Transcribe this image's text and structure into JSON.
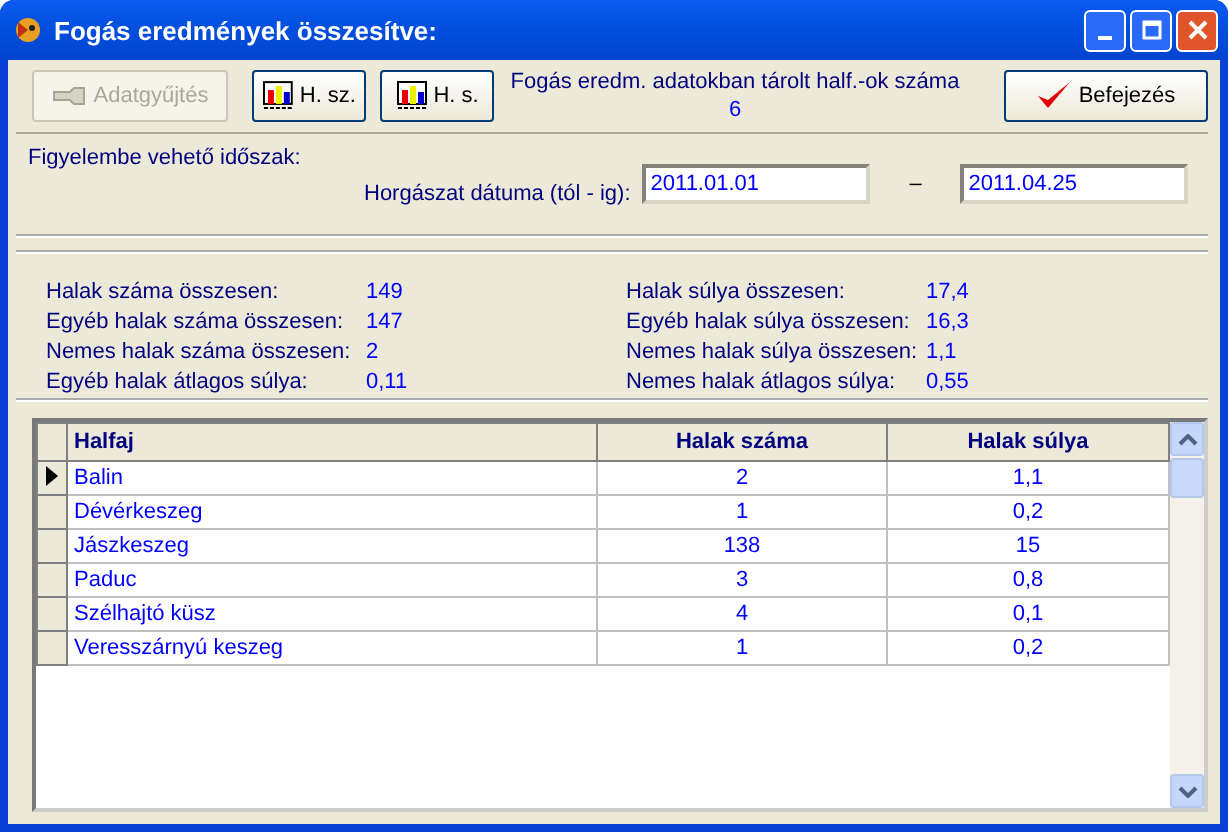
{
  "window": {
    "title": "Fogás eredmények összesítve:"
  },
  "toolbar": {
    "buttons": [
      {
        "label": "Adatgyűjtés",
        "kind": "collect",
        "disabled": true
      },
      {
        "label": "H. sz.",
        "kind": "chart",
        "disabled": false
      },
      {
        "label": "H. s.",
        "kind": "chart",
        "disabled": false
      }
    ],
    "stored_label": "Fogás eredm. adatokban tárolt half.-ok száma",
    "stored_value": "6",
    "finish": {
      "label": "Befejezés",
      "disabled": false
    }
  },
  "period": {
    "label": "Figyelembe vehető időszak:",
    "field_label": "Horgászat dátuma (tól - ig):",
    "from": "2011.01.01",
    "separator": "–",
    "to": "2011.04.25"
  },
  "stats": [
    [
      {
        "label": "Halak száma összesen:",
        "value": "149"
      },
      {
        "label": "Egyéb halak száma összesen:",
        "value": "147"
      },
      {
        "label": "Nemes halak száma összesen:",
        "value": "2"
      },
      {
        "label": "Egyéb halak átlagos súlya:",
        "value": "0,11"
      }
    ],
    [
      {
        "label": "Halak súlya összesen:",
        "value": "17,4"
      },
      {
        "label": "Egyéb halak súlya összesen:",
        "value": "16,3"
      },
      {
        "label": "Nemes halak súlya összesen:",
        "value": "1,1"
      },
      {
        "label": "Nemes halak átlagos súlya:",
        "value": "0,55"
      }
    ]
  ],
  "table": {
    "columns": [
      "Halfaj",
      "Halak száma",
      "Halak súlya"
    ],
    "rows": [
      {
        "cells": [
          "Balin",
          "2",
          "1,1"
        ],
        "selected": true
      },
      {
        "cells": [
          "Dévérkeszeg",
          "1",
          "0,2"
        ],
        "selected": false
      },
      {
        "cells": [
          "Jászkeszeg",
          "138",
          "15"
        ],
        "selected": false
      },
      {
        "cells": [
          "Paduc",
          "3",
          "0,8"
        ],
        "selected": false
      },
      {
        "cells": [
          "Szélhajtó küsz",
          "4",
          "0,1"
        ],
        "selected": false
      },
      {
        "cells": [
          "Veresszárnyú keszeg",
          "1",
          "0,2"
        ],
        "selected": false
      }
    ]
  }
}
